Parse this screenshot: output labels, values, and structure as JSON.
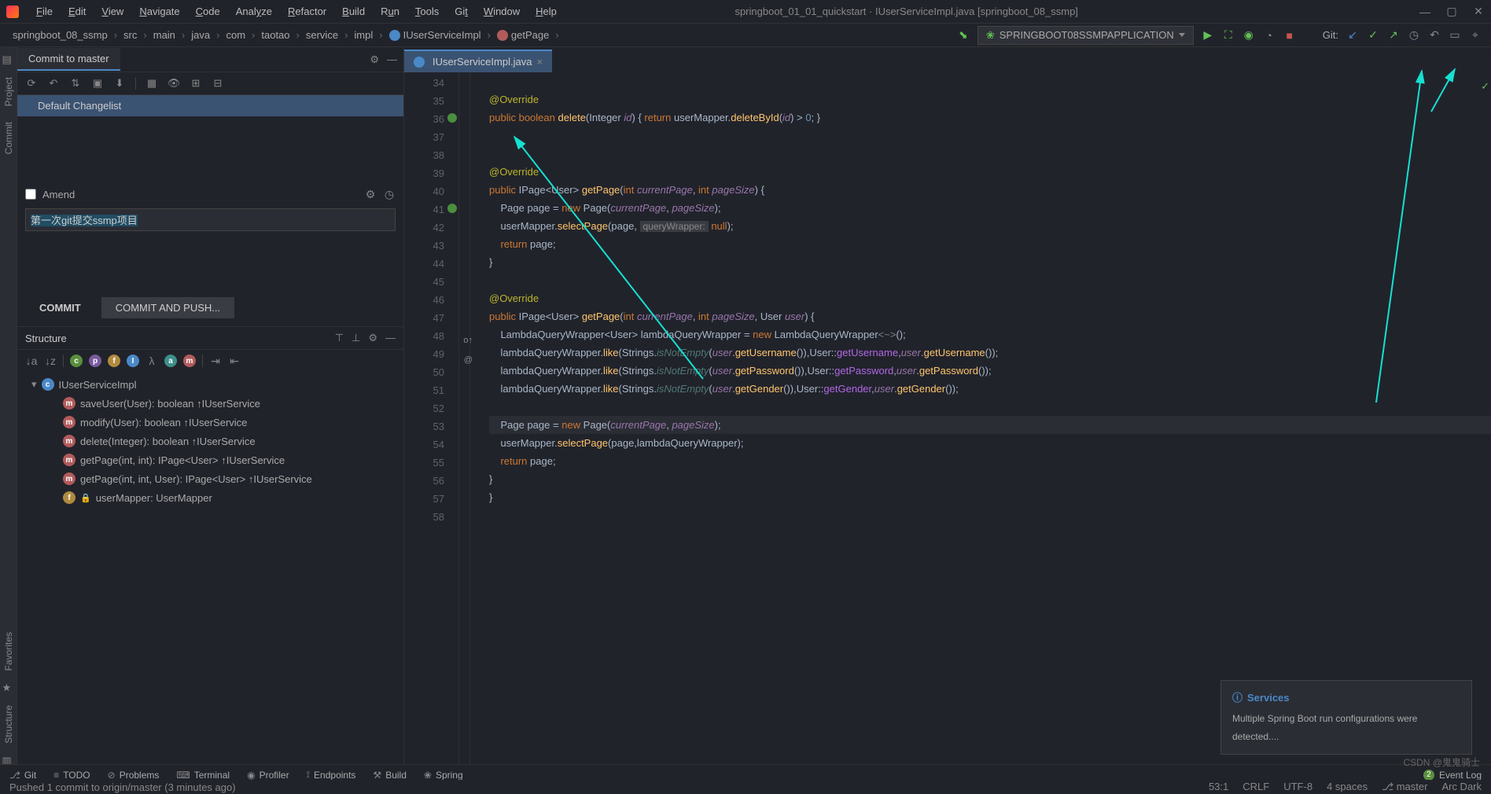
{
  "menubar": {
    "items": [
      "File",
      "Edit",
      "View",
      "Navigate",
      "Code",
      "Analyze",
      "Refactor",
      "Build",
      "Run",
      "Tools",
      "Git",
      "Window",
      "Help"
    ],
    "underline": [
      0,
      0,
      0,
      0,
      0,
      4,
      0,
      0,
      1,
      0,
      2,
      0,
      0
    ],
    "title": "springboot_01_01_quickstart · IUserServiceImpl.java [springboot_08_ssmp]"
  },
  "breadcrumb": [
    "springboot_08_ssmp",
    "src",
    "main",
    "java",
    "com",
    "taotao",
    "service",
    "impl",
    "IUserServiceImpl",
    "getPage"
  ],
  "runconfig": "SPRINGBOOT08SSMPAPPLICATION",
  "git_label": "Git:",
  "commit": {
    "tab": "Commit to master",
    "changelist": "Default Changelist",
    "amend": "Amend",
    "message": "第一次git提交ssmp项目",
    "commit_btn": "COMMIT",
    "push_btn": "COMMIT AND PUSH..."
  },
  "structure": {
    "title": "Structure",
    "class": "IUserServiceImpl",
    "members": [
      {
        "kind": "m",
        "label": "saveUser(User): boolean ↑IUserService"
      },
      {
        "kind": "m",
        "label": "modify(User): boolean ↑IUserService"
      },
      {
        "kind": "m",
        "label": "delete(Integer): boolean ↑IUserService"
      },
      {
        "kind": "m",
        "label": "getPage(int, int): IPage<User> ↑IUserService"
      },
      {
        "kind": "m",
        "label": "getPage(int, int, User): IPage<User> ↑IUserService"
      },
      {
        "kind": "f",
        "label": "userMapper: UserMapper"
      }
    ]
  },
  "editor": {
    "tab": "IUserServiceImpl.java",
    "lines_start": 34,
    "lines": [
      "",
      "<a>@Override</a>",
      "<k>public</k> <k>boolean</k> <m>delete</m>(<t>Integer</t> <p>id</p>) { <k>return</k> userMapper.<m>deleteById</m>(<p>id</p>) > <n>0</n>; }",
      "",
      "",
      "<a>@Override</a>",
      "<k>public</k> <t>IPage</t>&lt;<t>User</t>&gt; <m>getPage</m>(<k>int</k> <p>currentPage</p>, <k>int</k> <p>pageSize</p>) {",
      "    <t>Page</t> page = <k>new</k> <t>Page</t>(<p>currentPage</p>, <p>pageSize</p>);",
      "    userMapper.<m>selectPage</m>(page, <hint>queryWrapper:</hint> <k>null</k>);",
      "    <k>return</k> page;",
      "}",
      "",
      "<a>@Override</a>",
      "<k>public</k> <t>IPage</t>&lt;<t>User</t>&gt; <m>getPage</m>(<k>int</k> <p>currentPage</p>, <k>int</k> <p>pageSize</p>, <t>User</t> <p>user</p>) {",
      "    <t>LambdaQueryWrapper</t>&lt;<t>User</t>&gt; lambdaQueryWrapper = <k>new</k> <t>LambdaQueryWrapper</t><c>&lt;~&gt;</c>();",
      "    lambdaQueryWrapper.<m>like</m>(<t>Strings</t>.<it>isNotEmpty</it>(<p>user</p>.<m>getUsername</m>()),<t>User</t>::<hn>getUsername</hn>,<p>user</p>.<m>getUsername</m>());",
      "    lambdaQueryWrapper.<m>like</m>(<t>Strings</t>.<it>isNotEmpty</it>(<p>user</p>.<m>getPassword</m>()),<t>User</t>::<hn>getPassword</hn>,<p>user</p>.<m>getPassword</m>());",
      "    lambdaQueryWrapper.<m>like</m>(<t>Strings</t>.<it>isNotEmpty</it>(<p>user</p>.<m>getGender</m>()),<t>User</t>::<hn>getGender</hn>,<p>user</p>.<m>getGender</m>());",
      "",
      "    <t>Page</t> page = <k>new</k> <t>Page</t>(<p>currentPage</p>, <p>pageSize</p>);",
      "    userMapper.<m>selectPage</m>(page,lambdaQueryWrapper);",
      "    <k>return</k> page;",
      "}",
      "}",
      ""
    ]
  },
  "notif": {
    "title": "Services",
    "body": "Multiple Spring Boot run configurations were detected...."
  },
  "bottombar": {
    "items": [
      "Git",
      "TODO",
      "Problems",
      "Terminal",
      "Profiler",
      "Endpoints",
      "Build",
      "Spring"
    ],
    "event": "Event Log",
    "event_badge": "2"
  },
  "status": {
    "push": "Pushed 1 commit to origin/master (3 minutes ago)",
    "pos": "53:1",
    "crlf": "CRLF",
    "enc": "UTF-8",
    "indent": "4 spaces",
    "branch": "master",
    "tail": "Arc Dark"
  },
  "watermark": "CSDN @鬼鬼骑士",
  "left_tabs": [
    "Project",
    "Commit",
    "Favorites",
    "Structure"
  ]
}
